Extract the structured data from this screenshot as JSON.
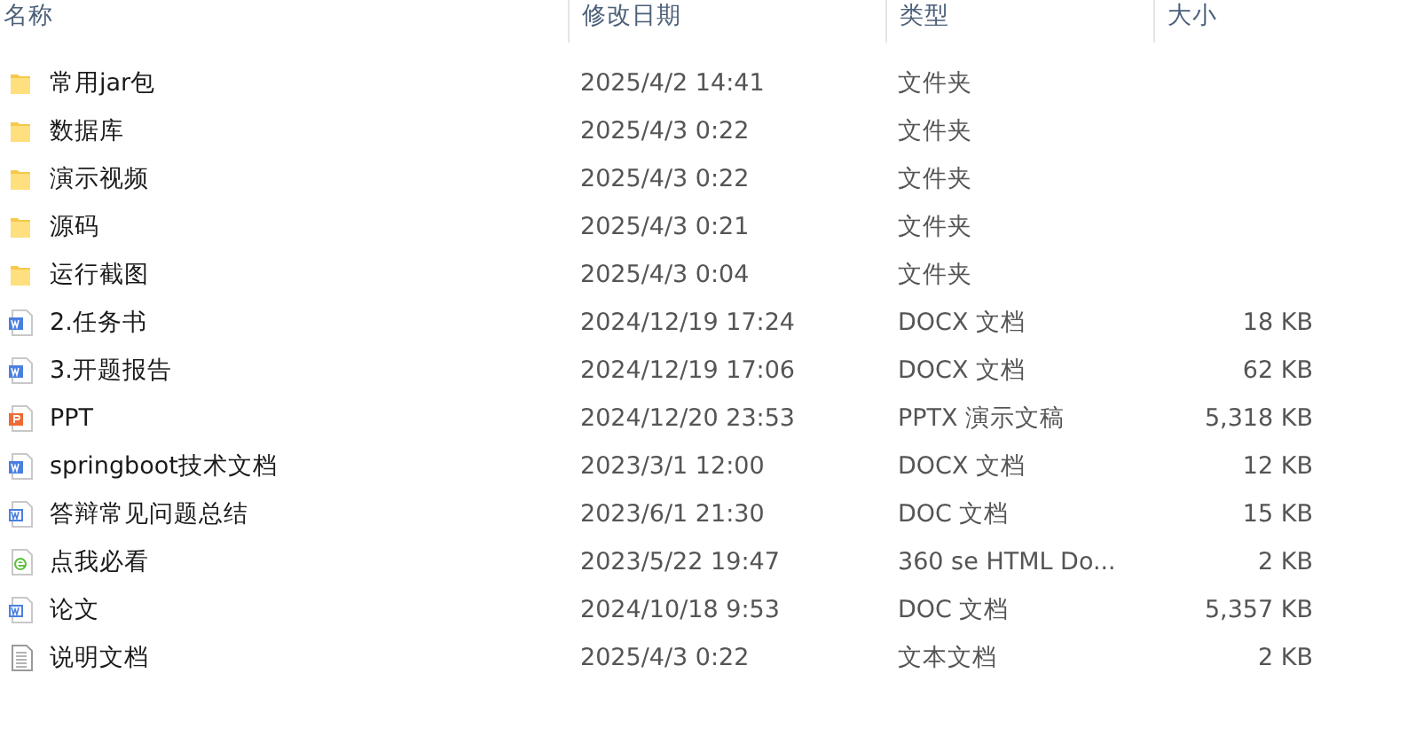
{
  "columns": [
    "名称",
    "修改日期",
    "类型",
    "大小"
  ],
  "files": [
    {
      "name": "常用jar包",
      "modified": "2025/4/2 14:41",
      "type": "文件夹",
      "kind": "folder"
    },
    {
      "name": "数据库",
      "modified": "2025/4/3 0:22",
      "type": "文件夹",
      "kind": "folder"
    },
    {
      "name": "演示视频",
      "modified": "2025/4/3 0:22",
      "type": "文件夹",
      "kind": "folder"
    },
    {
      "name": "源码",
      "modified": "2025/4/3 0:21",
      "type": "文件夹",
      "kind": "folder"
    },
    {
      "name": "运行截图",
      "modified": "2025/4/3 0:04",
      "type": "文件夹",
      "kind": "folder"
    },
    {
      "name": "2.任务书",
      "modified": "2024/12/19 17:24",
      "type": "DOCX 文档",
      "size": "18 KB",
      "kind": "docx"
    },
    {
      "name": "3.开题报告",
      "modified": "2024/12/19 17:06",
      "type": "DOCX 文档",
      "size": "62 KB",
      "kind": "docx"
    },
    {
      "name": "PPT",
      "modified": "2024/12/20 23:53",
      "type": "PPTX 演示文稿",
      "size": "5,318 KB",
      "kind": "pptx"
    },
    {
      "name": "springboot技术文档",
      "modified": "2023/3/1 12:00",
      "type": "DOCX 文档",
      "size": "12 KB",
      "kind": "docx"
    },
    {
      "name": "答辩常见问题总结",
      "modified": "2023/6/1 21:30",
      "type": "DOC 文档",
      "size": "15 KB",
      "kind": "doc"
    },
    {
      "name": "点我必看",
      "modified": "2023/5/22 19:47",
      "type": "360 se HTML Do...",
      "size": "2 KB",
      "kind": "html"
    },
    {
      "name": "论文",
      "modified": "2024/10/18 9:53",
      "type": "DOC 文档",
      "size": "5,357 KB",
      "kind": "doc"
    },
    {
      "name": "说明文档",
      "modified": "2025/4/3 0:22",
      "type": "文本文档",
      "size": "2 KB",
      "kind": "txt"
    }
  ]
}
